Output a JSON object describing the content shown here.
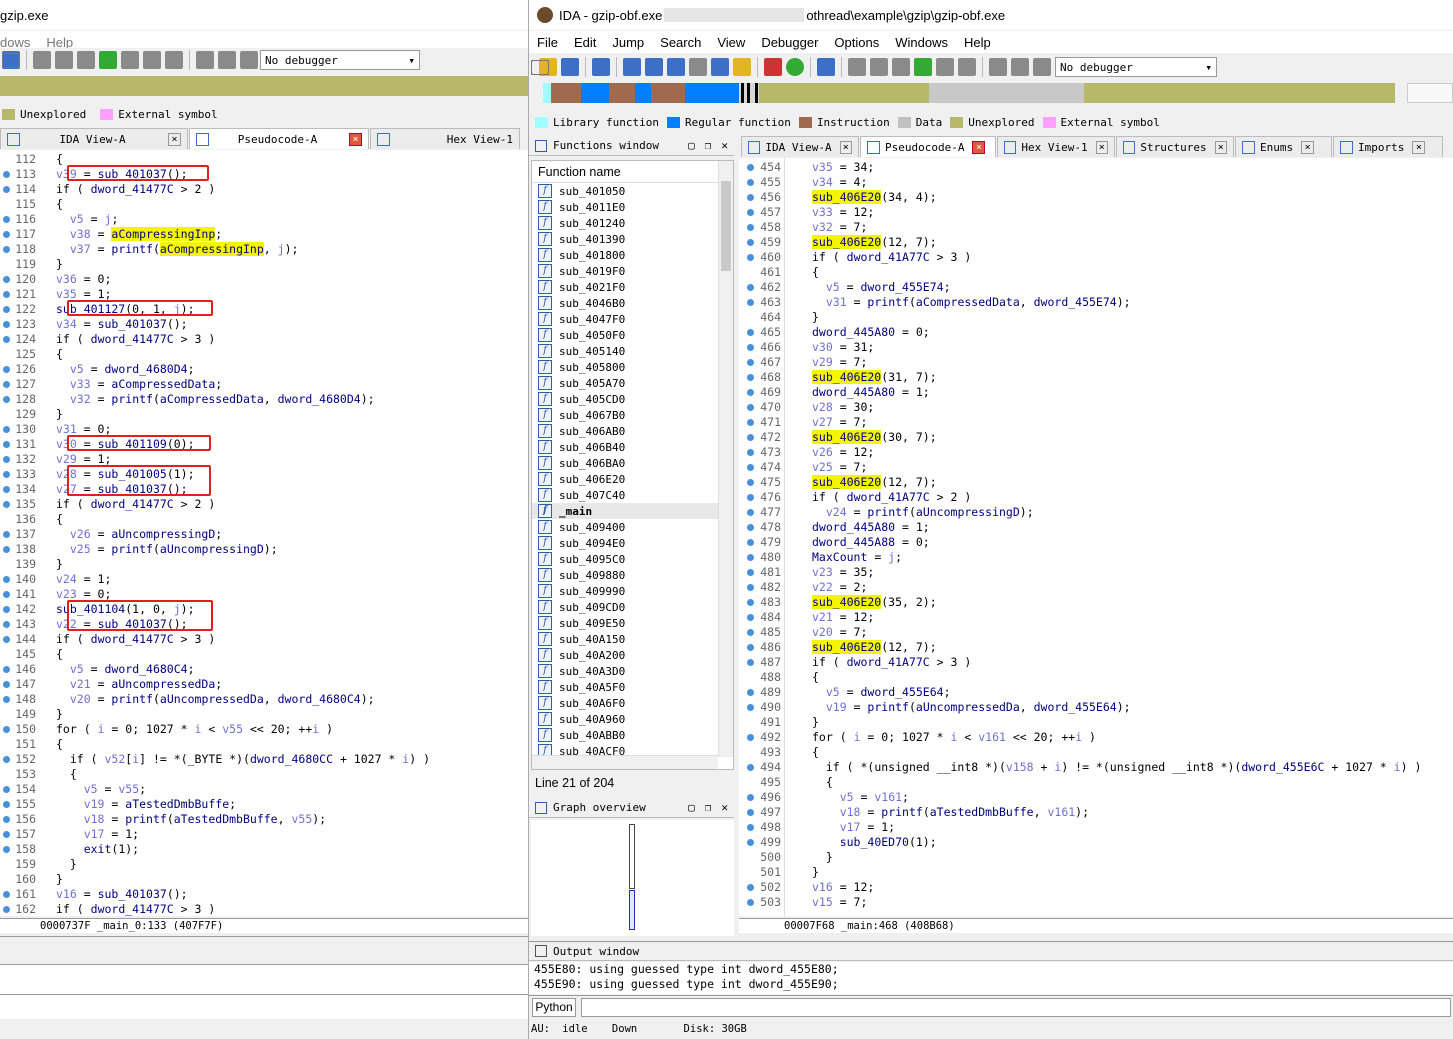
{
  "left_window": {
    "title": "gzip.exe",
    "menu": [
      "dows",
      "Help"
    ],
    "debugger": "No debugger",
    "legend": [
      {
        "label": "Unexplored",
        "color": "#b8b86a"
      },
      {
        "label": "External symbol",
        "color": "#ffa0ff"
      }
    ],
    "tabs": [
      {
        "label": "IDA View-A",
        "active": false
      },
      {
        "label": "Pseudocode-A",
        "active": true
      },
      {
        "label": "Hex View-1",
        "active": false
      }
    ],
    "code_lines": [
      {
        "n": "112",
        "dot": false,
        "t": "{"
      },
      {
        "n": "113",
        "dot": true,
        "t": "v39 = sub_401037();"
      },
      {
        "n": "114",
        "dot": true,
        "t": "if ( dword_41477C > 2 )"
      },
      {
        "n": "115",
        "dot": false,
        "t": "{"
      },
      {
        "n": "116",
        "dot": true,
        "t": "  v5 = j;"
      },
      {
        "n": "117",
        "dot": true,
        "t": "  v38 = aCompressingInp;"
      },
      {
        "n": "118",
        "dot": true,
        "t": "  v37 = printf(aCompressingInp, j);"
      },
      {
        "n": "119",
        "dot": false,
        "t": "}"
      },
      {
        "n": "120",
        "dot": true,
        "t": "v36 = 0;"
      },
      {
        "n": "121",
        "dot": true,
        "t": "v35 = 1;"
      },
      {
        "n": "122",
        "dot": true,
        "t": "sub_401127(0, 1, j);"
      },
      {
        "n": "123",
        "dot": true,
        "t": "v34 = sub_401037();"
      },
      {
        "n": "124",
        "dot": true,
        "t": "if ( dword_41477C > 3 )"
      },
      {
        "n": "125",
        "dot": false,
        "t": "{"
      },
      {
        "n": "126",
        "dot": true,
        "t": "  v5 = dword_4680D4;"
      },
      {
        "n": "127",
        "dot": true,
        "t": "  v33 = aCompressedData;"
      },
      {
        "n": "128",
        "dot": true,
        "t": "  v32 = printf(aCompressedData, dword_4680D4);"
      },
      {
        "n": "129",
        "dot": false,
        "t": "}"
      },
      {
        "n": "130",
        "dot": true,
        "t": "v31 = 0;"
      },
      {
        "n": "131",
        "dot": true,
        "t": "v30 = sub_401109(0);"
      },
      {
        "n": "132",
        "dot": true,
        "t": "v29 = 1;"
      },
      {
        "n": "133",
        "dot": true,
        "t": "v28 = sub_401005(1);"
      },
      {
        "n": "134",
        "dot": true,
        "t": "v27 = sub_401037();"
      },
      {
        "n": "135",
        "dot": true,
        "t": "if ( dword_41477C > 2 )"
      },
      {
        "n": "136",
        "dot": false,
        "t": "{"
      },
      {
        "n": "137",
        "dot": true,
        "t": "  v26 = aUncompressingD;"
      },
      {
        "n": "138",
        "dot": true,
        "t": "  v25 = printf(aUncompressingD);"
      },
      {
        "n": "139",
        "dot": false,
        "t": "}"
      },
      {
        "n": "140",
        "dot": true,
        "t": "v24 = 1;"
      },
      {
        "n": "141",
        "dot": true,
        "t": "v23 = 0;"
      },
      {
        "n": "142",
        "dot": true,
        "t": "sub_401104(1, 0, j);"
      },
      {
        "n": "143",
        "dot": true,
        "t": "v22 = sub_401037();"
      },
      {
        "n": "144",
        "dot": true,
        "t": "if ( dword_41477C > 3 )"
      },
      {
        "n": "145",
        "dot": false,
        "t": "{"
      },
      {
        "n": "146",
        "dot": true,
        "t": "  v5 = dword_4680C4;"
      },
      {
        "n": "147",
        "dot": true,
        "t": "  v21 = aUncompressedDa;"
      },
      {
        "n": "148",
        "dot": true,
        "t": "  v20 = printf(aUncompressedDa, dword_4680C4);"
      },
      {
        "n": "149",
        "dot": false,
        "t": "}"
      },
      {
        "n": "150",
        "dot": true,
        "t": "for ( i = 0; 1027 * i < v55 << 20; ++i )"
      },
      {
        "n": "151",
        "dot": false,
        "t": "{"
      },
      {
        "n": "152",
        "dot": true,
        "t": "  if ( v52[i] != *(_BYTE *)(dword_4680CC + 1027 * i) )"
      },
      {
        "n": "153",
        "dot": false,
        "t": "  {"
      },
      {
        "n": "154",
        "dot": true,
        "t": "    v5 = v55;"
      },
      {
        "n": "155",
        "dot": true,
        "t": "    v19 = aTestedDmbBuffe;"
      },
      {
        "n": "156",
        "dot": true,
        "t": "    v18 = printf(aTestedDmbBuffe, v55);"
      },
      {
        "n": "157",
        "dot": true,
        "t": "    v17 = 1;"
      },
      {
        "n": "158",
        "dot": true,
        "t": "    exit(1);"
      },
      {
        "n": "159",
        "dot": false,
        "t": "  }"
      },
      {
        "n": "160",
        "dot": false,
        "t": "}"
      },
      {
        "n": "161",
        "dot": true,
        "t": "v16 = sub_401037();"
      },
      {
        "n": "162",
        "dot": true,
        "t": "if ( dword_41477C > 3 )"
      }
    ],
    "status": "0000737F _main_0:133 (407F7F)"
  },
  "right_window": {
    "title_prefix": "IDA - gzip-obf.exe",
    "title_suffix": "othread\\example\\gzip\\gzip-obf.exe",
    "menu": [
      "File",
      "Edit",
      "Jump",
      "Search",
      "View",
      "Debugger",
      "Options",
      "Windows",
      "Help"
    ],
    "debugger": "No debugger",
    "legend": [
      {
        "label": "Library function",
        "color": "#a0ffff"
      },
      {
        "label": "Regular function",
        "color": "#0080ff"
      },
      {
        "label": "Instruction",
        "color": "#a06a50"
      },
      {
        "label": "Data",
        "color": "#c0c0c0"
      },
      {
        "label": "Unexplored",
        "color": "#b8b86a"
      },
      {
        "label": "External symbol",
        "color": "#ffa0ff"
      }
    ],
    "functions_window": {
      "title": "Functions window",
      "column": "Function name",
      "items": [
        "sub_401050",
        "sub_4011E0",
        "sub_401240",
        "sub_401390",
        "sub_401800",
        "sub_4019F0",
        "sub_4021F0",
        "sub_4046B0",
        "sub_4047F0",
        "sub_4050F0",
        "sub_405140",
        "sub_405800",
        "sub_405A70",
        "sub_405CD0",
        "sub_4067B0",
        "sub_406AB0",
        "sub_406B40",
        "sub_406BA0",
        "sub_406E20",
        "sub_407C40",
        "_main",
        "sub_409400",
        "sub_4094E0",
        "sub_4095C0",
        "sub_409880",
        "sub_409990",
        "sub_409CD0",
        "sub_409E50",
        "sub_40A150",
        "sub_40A200",
        "sub_40A3D0",
        "sub_40A5F0",
        "sub_40A6F0",
        "sub_40A960",
        "sub_40ABB0",
        "sub_40ACF0"
      ],
      "line_info": "Line 21 of 204"
    },
    "graph_overview": {
      "title": "Graph overview"
    },
    "tabs": [
      {
        "label": "IDA View-A",
        "active": false
      },
      {
        "label": "Pseudocode-A",
        "active": true
      },
      {
        "label": "Hex View-1",
        "active": false
      },
      {
        "label": "Structures",
        "active": false
      },
      {
        "label": "Enums",
        "active": false
      },
      {
        "label": "Imports",
        "active": false
      }
    ],
    "code_lines": [
      {
        "n": "454",
        "dot": true,
        "t": "v35 = 34;"
      },
      {
        "n": "455",
        "dot": true,
        "t": "v34 = 4;"
      },
      {
        "n": "456",
        "dot": true,
        "t": "sub_406E20(34, 4);"
      },
      {
        "n": "457",
        "dot": true,
        "t": "v33 = 12;"
      },
      {
        "n": "458",
        "dot": true,
        "t": "v32 = 7;"
      },
      {
        "n": "459",
        "dot": true,
        "t": "sub_406E20(12, 7);"
      },
      {
        "n": "460",
        "dot": true,
        "t": "if ( dword_41A77C > 3 )"
      },
      {
        "n": "461",
        "dot": false,
        "t": "{"
      },
      {
        "n": "462",
        "dot": true,
        "t": "  v5 = dword_455E74;"
      },
      {
        "n": "463",
        "dot": true,
        "t": "  v31 = printf(aCompressedData, dword_455E74);"
      },
      {
        "n": "464",
        "dot": false,
        "t": "}"
      },
      {
        "n": "465",
        "dot": true,
        "t": "dword_445A80 = 0;"
      },
      {
        "n": "466",
        "dot": true,
        "t": "v30 = 31;"
      },
      {
        "n": "467",
        "dot": true,
        "t": "v29 = 7;"
      },
      {
        "n": "468",
        "dot": true,
        "t": "sub_406E20(31, 7);"
      },
      {
        "n": "469",
        "dot": true,
        "t": "dword_445A80 = 1;"
      },
      {
        "n": "470",
        "dot": true,
        "t": "v28 = 30;"
      },
      {
        "n": "471",
        "dot": true,
        "t": "v27 = 7;"
      },
      {
        "n": "472",
        "dot": true,
        "t": "sub_406E20(30, 7);"
      },
      {
        "n": "473",
        "dot": true,
        "t": "v26 = 12;"
      },
      {
        "n": "474",
        "dot": true,
        "t": "v25 = 7;"
      },
      {
        "n": "475",
        "dot": true,
        "t": "sub_406E20(12, 7);"
      },
      {
        "n": "476",
        "dot": true,
        "t": "if ( dword_41A77C > 2 )"
      },
      {
        "n": "477",
        "dot": true,
        "t": "  v24 = printf(aUncompressingD);"
      },
      {
        "n": "478",
        "dot": true,
        "t": "dword_445A80 = 1;"
      },
      {
        "n": "479",
        "dot": true,
        "t": "dword_445A88 = 0;"
      },
      {
        "n": "480",
        "dot": true,
        "t": "MaxCount = j;"
      },
      {
        "n": "481",
        "dot": true,
        "t": "v23 = 35;"
      },
      {
        "n": "482",
        "dot": true,
        "t": "v22 = 2;"
      },
      {
        "n": "483",
        "dot": true,
        "t": "sub_406E20(35, 2);"
      },
      {
        "n": "484",
        "dot": true,
        "t": "v21 = 12;"
      },
      {
        "n": "485",
        "dot": true,
        "t": "v20 = 7;"
      },
      {
        "n": "486",
        "dot": true,
        "t": "sub_406E20(12, 7);"
      },
      {
        "n": "487",
        "dot": true,
        "t": "if ( dword_41A77C > 3 )"
      },
      {
        "n": "488",
        "dot": false,
        "t": "{"
      },
      {
        "n": "489",
        "dot": true,
        "t": "  v5 = dword_455E64;"
      },
      {
        "n": "490",
        "dot": true,
        "t": "  v19 = printf(aUncompressedDa, dword_455E64);"
      },
      {
        "n": "491",
        "dot": false,
        "t": "}"
      },
      {
        "n": "492",
        "dot": true,
        "t": "for ( i = 0; 1027 * i < v161 << 20; ++i )"
      },
      {
        "n": "493",
        "dot": false,
        "t": "{"
      },
      {
        "n": "494",
        "dot": true,
        "t": "  if ( *(unsigned __int8 *)(v158 + i) != *(unsigned __int8 *)(dword_455E6C + 1027 * i) )"
      },
      {
        "n": "495",
        "dot": false,
        "t": "  {"
      },
      {
        "n": "496",
        "dot": true,
        "t": "    v5 = v161;"
      },
      {
        "n": "497",
        "dot": true,
        "t": "    v18 = printf(aTestedDmbBuffe, v161);"
      },
      {
        "n": "498",
        "dot": true,
        "t": "    v17 = 1;"
      },
      {
        "n": "499",
        "dot": true,
        "t": "    sub_40ED70(1);"
      },
      {
        "n": "500",
        "dot": false,
        "t": "  }"
      },
      {
        "n": "501",
        "dot": false,
        "t": "}"
      },
      {
        "n": "502",
        "dot": true,
        "t": "v16 = 12;"
      },
      {
        "n": "503",
        "dot": true,
        "t": "v15 = 7;"
      }
    ],
    "status": "00007F68 _main:468 (408B68)",
    "output_window": {
      "title": "Output window",
      "lines": [
        "455E80: using guessed type int dword_455E80;",
        "455E90: using guessed type int dword_455E90;"
      ]
    },
    "python_button": "Python",
    "statusbar": {
      "au": "AU:",
      "state": "idle",
      "dir": "Down",
      "disk": "Disk: 30GB"
    }
  }
}
